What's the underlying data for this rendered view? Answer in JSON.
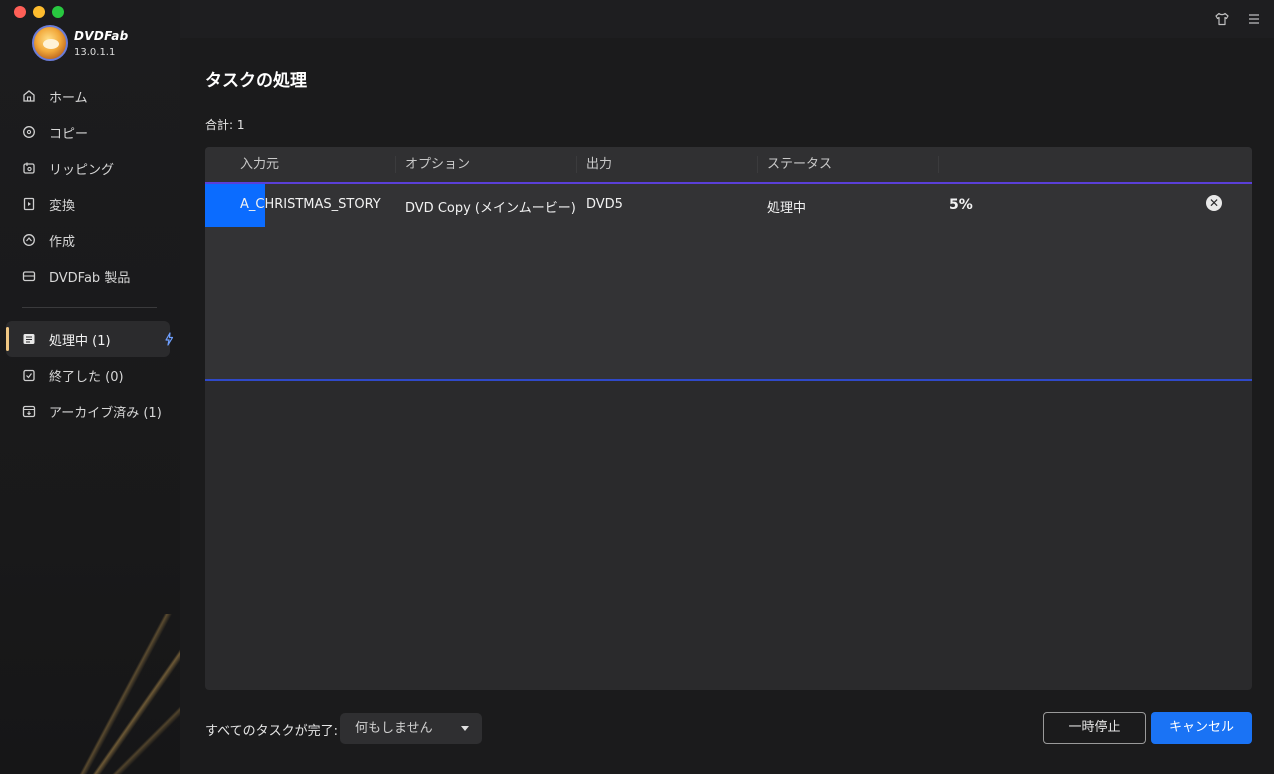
{
  "window": {
    "traffic_colors": [
      "#ff5f57",
      "#febc2e",
      "#28c840"
    ]
  },
  "brand": {
    "name": "DVDFab",
    "version": "13.0.1.1"
  },
  "sidebar": {
    "items": [
      {
        "label": "ホーム",
        "icon": "home-icon"
      },
      {
        "label": "コピー",
        "icon": "copy-disc-icon"
      },
      {
        "label": "リッピング",
        "icon": "ripping-icon"
      },
      {
        "label": "変換",
        "icon": "convert-icon"
      },
      {
        "label": "作成",
        "icon": "create-icon"
      },
      {
        "label": "DVDFab 製品",
        "icon": "products-icon"
      }
    ],
    "tasks": [
      {
        "label": "処理中 (1)",
        "icon": "processing-icon",
        "active": true
      },
      {
        "label": "終了した (0)",
        "icon": "finished-icon"
      },
      {
        "label": "アーカイブ済み (1)",
        "icon": "archive-icon"
      }
    ]
  },
  "main": {
    "title": "タスクの処理",
    "total": "合計: 1"
  },
  "table": {
    "headers": [
      "入力元",
      "オプション",
      "出力",
      "ステータス"
    ],
    "rows": [
      {
        "source": "A_CHRISTMAS_STORY",
        "option": "DVD Copy (メインムービー)",
        "output": "DVD5",
        "status": "処理中",
        "percent": "5%",
        "progress_fraction": 0.05
      }
    ]
  },
  "footer": {
    "after_label": "すべてのタスクが完了:",
    "after_value": "何もしません",
    "pause_label": "一時停止",
    "cancel_label": "キャンセル"
  },
  "colors": {
    "accent_blue": "#1a73f5",
    "active_marker": "#f0c784",
    "processing_icon": "#6fa0ff"
  }
}
